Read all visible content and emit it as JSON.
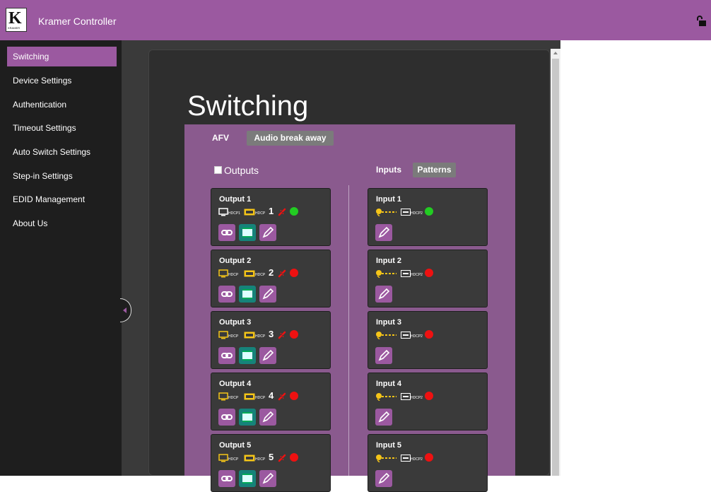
{
  "header": {
    "app_title": "Kramer Controller",
    "logo_letter": "K",
    "logo_sub": "KRAMER",
    "brand_color": "#9b59a0",
    "lock_icon": "unlock-icon"
  },
  "sidebar": {
    "items": [
      {
        "label": "Switching",
        "active": true
      },
      {
        "label": "Device Settings",
        "active": false
      },
      {
        "label": "Authentication",
        "active": false
      },
      {
        "label": "Timeout Settings",
        "active": false
      },
      {
        "label": "Auto Switch Settings",
        "active": false
      },
      {
        "label": "Step-in Settings",
        "active": false
      },
      {
        "label": "EDID Management",
        "active": false
      },
      {
        "label": "About Us",
        "active": false
      }
    ]
  },
  "main": {
    "page_title": "Switching",
    "tabs": [
      {
        "label": "AFV",
        "active": true
      },
      {
        "label": "Audio break away",
        "active": false
      }
    ],
    "outputs_label": "Outputs",
    "input_tabs": [
      {
        "label": "Inputs",
        "active": true
      },
      {
        "label": "Patterns",
        "active": false
      }
    ],
    "outputs": [
      {
        "title": "Output 1",
        "number": "1",
        "hdcp": "HDCP1",
        "hdcp2": "HDCP",
        "monitor_color": "#ffffff",
        "status_color": "#22cc22"
      },
      {
        "title": "Output 2",
        "number": "2",
        "hdcp": "HDCP",
        "hdcp2": "HDCP",
        "monitor_color": "#f5c518",
        "status_color": "#ee1111"
      },
      {
        "title": "Output 3",
        "number": "3",
        "hdcp": "HDCP",
        "hdcp2": "HDCP",
        "monitor_color": "#f5c518",
        "status_color": "#ee1111"
      },
      {
        "title": "Output 4",
        "number": "4",
        "hdcp": "HDCP",
        "hdcp2": "HDCP",
        "monitor_color": "#f5c518",
        "status_color": "#ee1111"
      },
      {
        "title": "Output 5",
        "number": "5",
        "hdcp": "HDCP",
        "hdcp2": "HDCP",
        "monitor_color": "#f5c518",
        "status_color": "#ee1111"
      }
    ],
    "inputs": [
      {
        "title": "Input 1",
        "hdcp": "HDCP2",
        "status_color": "#22cc22"
      },
      {
        "title": "Input 2",
        "hdcp": "HDCP2",
        "status_color": "#ee1111"
      },
      {
        "title": "Input 3",
        "hdcp": "HDCP2",
        "status_color": "#ee1111"
      },
      {
        "title": "Input 4",
        "hdcp": "HDCP2",
        "status_color": "#ee1111"
      },
      {
        "title": "Input 5",
        "hdcp": "HDCP2",
        "status_color": "#ee1111"
      }
    ]
  }
}
